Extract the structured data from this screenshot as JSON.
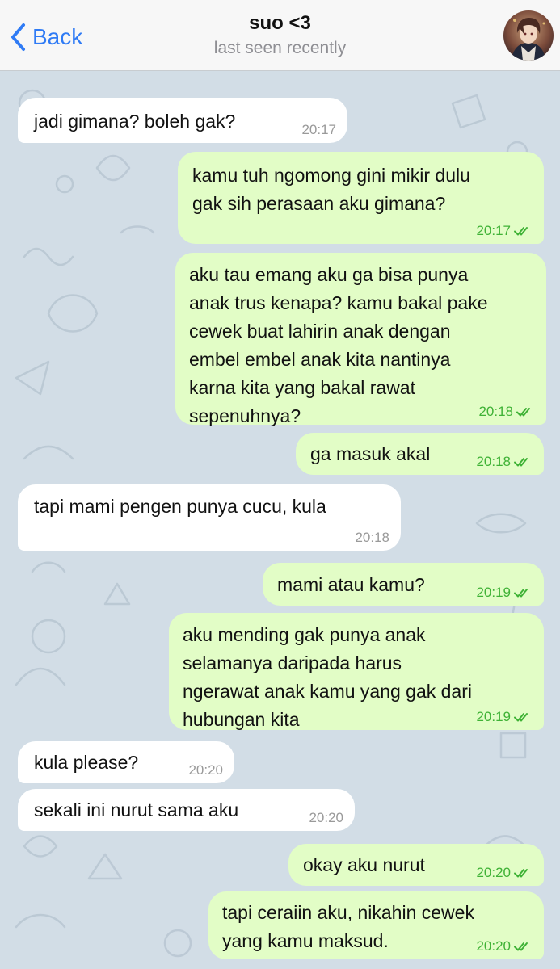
{
  "header": {
    "back_label": "Back",
    "contact_name": "suo <3",
    "status": "last seen recently"
  },
  "colors": {
    "accent": "#2f7bf5",
    "outgoing_bubble": "#e2fdc6",
    "incoming_bubble": "#ffffff",
    "time_outgoing": "#3fb236",
    "time_incoming": "#9a9a9a"
  },
  "messages": [
    {
      "direction": "in",
      "text": "jadi gimana? boleh gak?",
      "time": "20:17"
    },
    {
      "direction": "out",
      "text": "kamu tuh ngomong gini mikir dulu\ngak sih perasaan aku gimana?",
      "time": "20:17",
      "read": true
    },
    {
      "direction": "out",
      "text": "aku tau emang aku ga bisa punya\nanak trus kenapa? kamu bakal pake\ncewek buat lahirin anak dengan\nembel embel anak kita nantinya\nkarna kita yang bakal rawat\nsepenuhnya?",
      "time": "20:18",
      "read": true
    },
    {
      "direction": "out",
      "text": "ga masuk akal",
      "time": "20:18",
      "read": true
    },
    {
      "direction": "in",
      "text": "tapi mami pengen punya cucu, kula",
      "time": "20:18"
    },
    {
      "direction": "out",
      "text": "mami atau kamu?",
      "time": "20:19",
      "read": true
    },
    {
      "direction": "out",
      "text": "aku mending gak punya anak\nselamanya daripada harus\nngerawat anak kamu yang gak dari\nhubungan kita",
      "time": "20:19",
      "read": true
    },
    {
      "direction": "in",
      "text": "kula please?",
      "time": "20:20"
    },
    {
      "direction": "in",
      "text": "sekali ini nurut sama aku",
      "time": "20:20"
    },
    {
      "direction": "out",
      "text": "okay aku nurut",
      "time": "20:20",
      "read": true
    },
    {
      "direction": "out",
      "text": "tapi ceraiin aku, nikahin cewek\nyang kamu maksud.",
      "time": "20:20",
      "read": true
    }
  ]
}
